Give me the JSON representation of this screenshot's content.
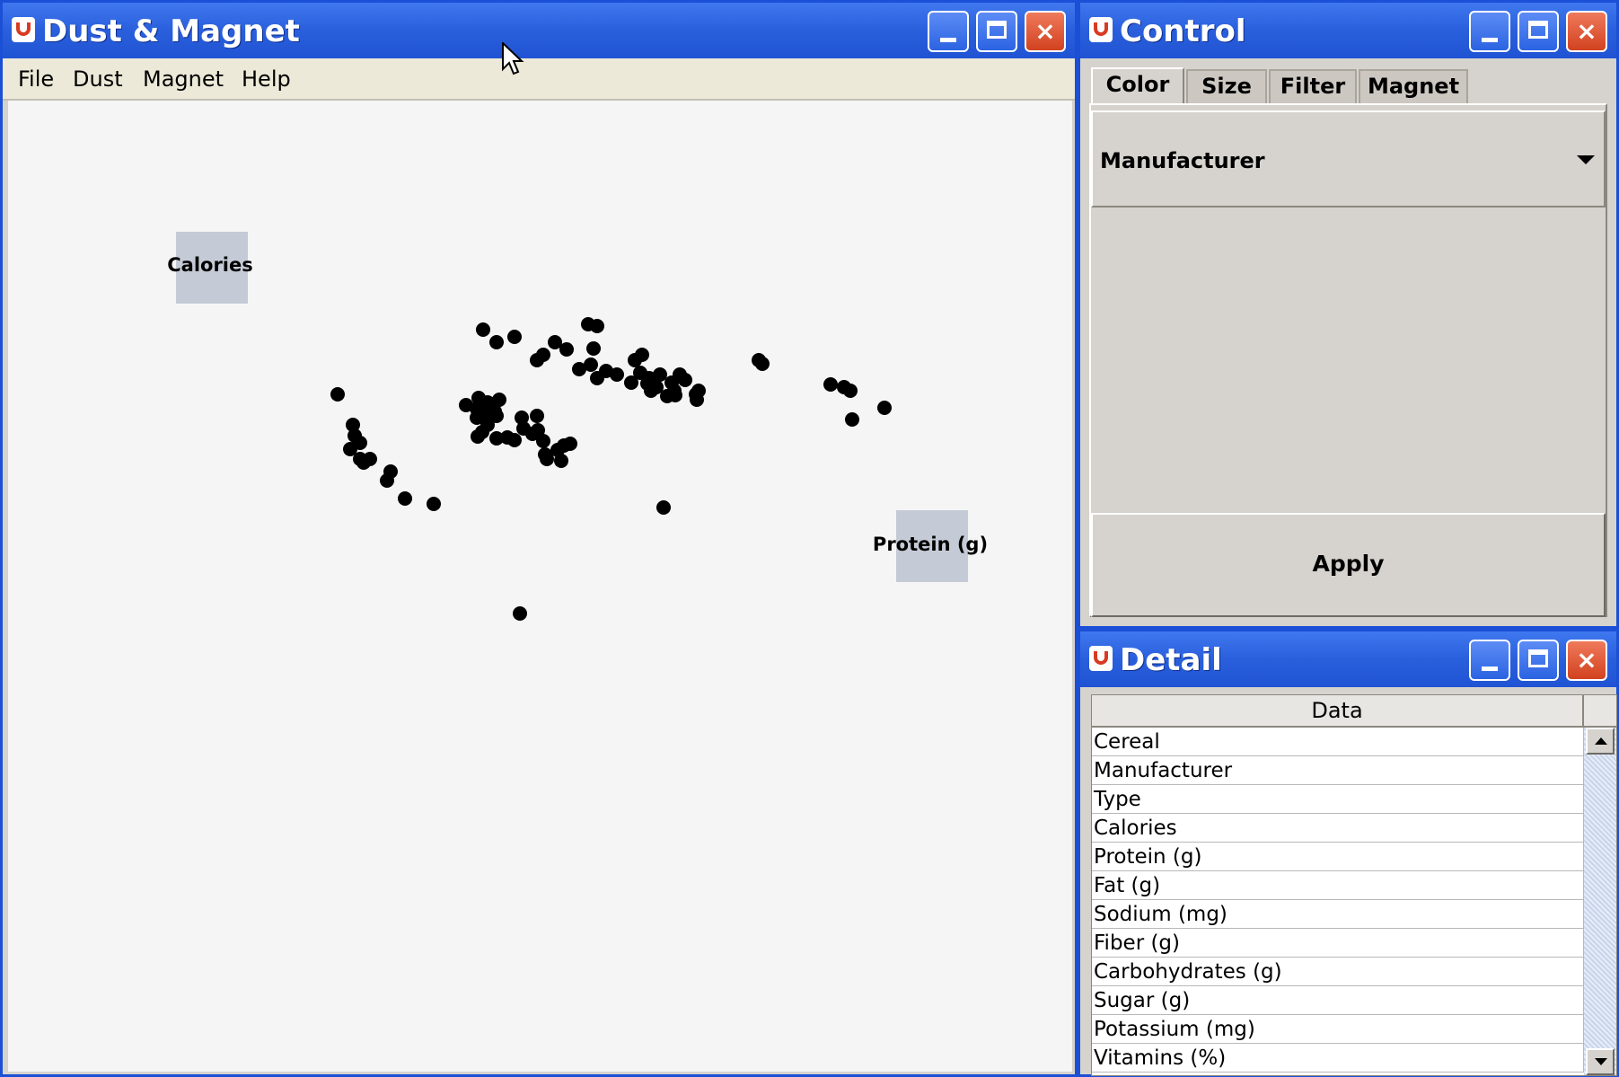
{
  "main": {
    "title": "Dust & Magnet",
    "menu": [
      "File",
      "Dust",
      "Magnet",
      "Help"
    ],
    "magnets": [
      {
        "label": "Calories"
      },
      {
        "label": "Protein (g)"
      }
    ]
  },
  "control": {
    "title": "Control",
    "tabs": [
      "Color",
      "Size",
      "Filter",
      "Magnet"
    ],
    "active_tab": "Color",
    "color_attribute": "Manufacturer",
    "apply_label": "Apply"
  },
  "detail": {
    "title": "Detail",
    "column_header": "Data",
    "rows": [
      "Cereal",
      "Manufacturer",
      "Type",
      "Calories",
      "Protein (g)",
      "Fat (g)",
      "Sodium (mg)",
      "Fiber (g)",
      "Carbohydrates (g)",
      "Sugar (g)",
      "Potassium (mg)",
      "Vitamins (%)"
    ]
  },
  "window_buttons": {
    "minimize": "minimize",
    "maximize": "maximize",
    "close": "×"
  },
  "colors": {
    "titlebar": "#2a5fdc",
    "dust": "#000000",
    "magnet": "#c5cbd6",
    "close": "#d2421f"
  }
}
